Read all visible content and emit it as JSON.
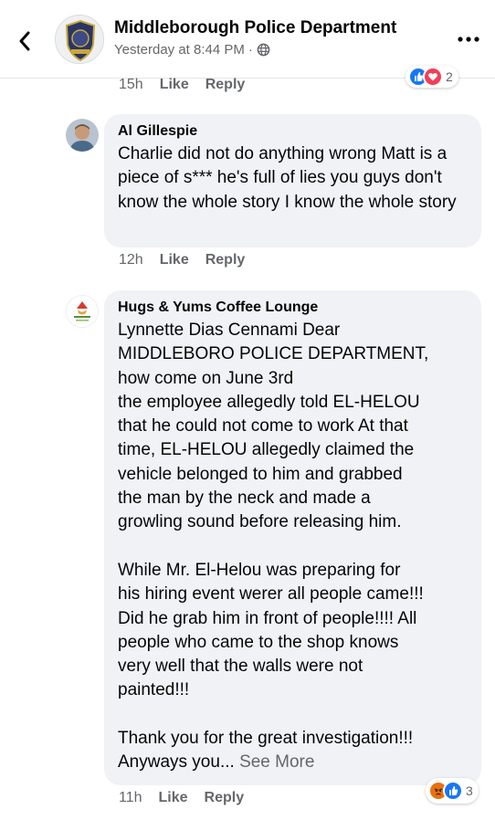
{
  "header": {
    "page_name": "Middleborough Police Department",
    "timestamp": "Yesterday at 8:44 PM",
    "separator": "·",
    "audience_icon": "globe-icon",
    "back_icon": "chevron-left-icon",
    "more_icon": "more-dots-icon"
  },
  "top_partial": {
    "time": "15h",
    "like": "Like",
    "reply": "Reply",
    "reaction_count": "2"
  },
  "comments": [
    {
      "author": "Al Gillespie",
      "text": "Charlie did not do anything wrong Matt is a piece of s*** he's full of lies you guys don't know the whole story I know the whole story",
      "time": "12h",
      "like": "Like",
      "reply": "Reply"
    },
    {
      "author": "Hugs & Yums Coffee Lounge",
      "text": "Lynnette Dias Cennami Dear\nMIDDLEBORO POLICE DEPARTMENT,\nhow come on June 3rd\nthe employee allegedly told EL-HELOU\nthat he could not come to work  At that\ntime, EL-HELOU allegedly claimed the\nvehicle belonged to him and grabbed\nthe man by the neck and made a\ngrowling sound before releasing him.\n\nWhile Mr. El-Helou was preparing for\nhis hiring event werer all people came!!!\nDid he grab him in front of people!!!! All\npeople who came to the shop knows\nvery well that the walls were not\npainted!!!\n\nThank you for the great investigation!!!\nAnyways you...",
      "see_more": "See More",
      "time": "11h",
      "like": "Like",
      "reply": "Reply",
      "reaction_count": "3"
    }
  ],
  "colors": {
    "bubble": "#f0f2f5",
    "secondary_text": "#65676b",
    "like_blue": "#1877f2",
    "love_red": "#f33e58",
    "angry_orange": "#e9710f"
  }
}
